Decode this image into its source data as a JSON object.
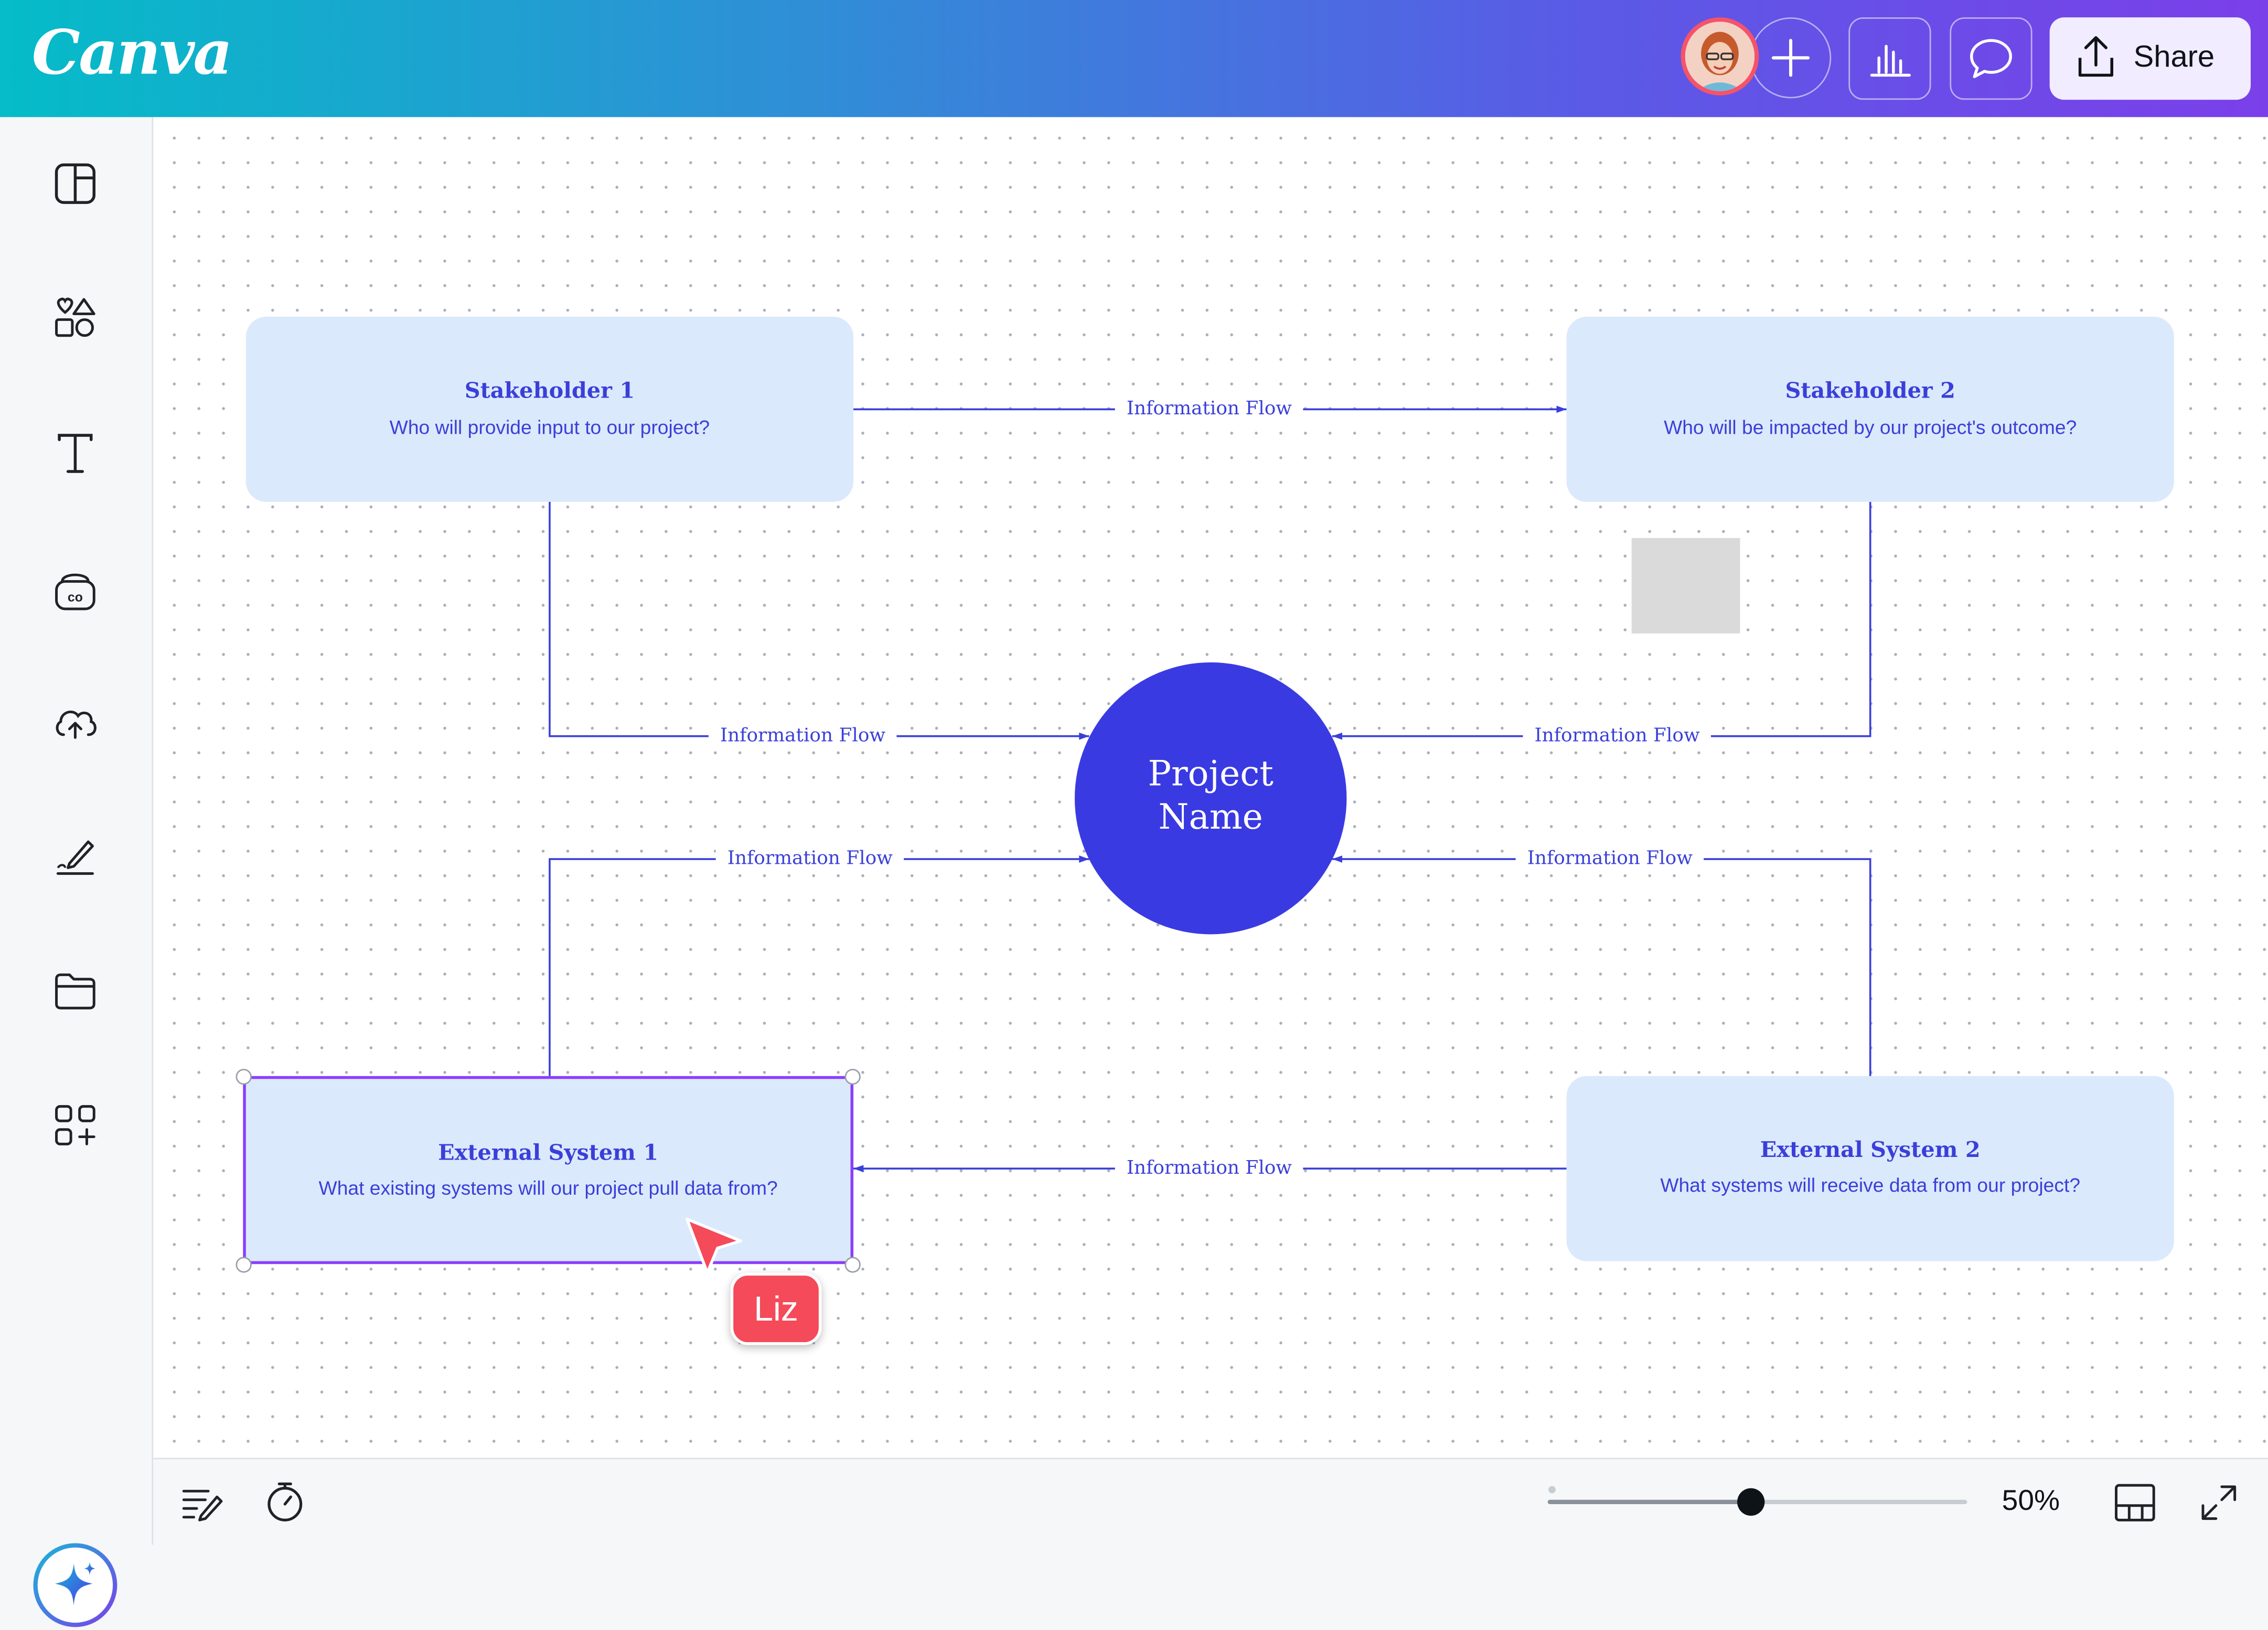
{
  "app": {
    "logo": "Canva"
  },
  "header": {
    "share_label": "Share",
    "collaborator_name": "Liz"
  },
  "diagram": {
    "center": {
      "line1": "Project",
      "line2": "Name"
    },
    "boxes": [
      {
        "title": "Stakeholder 1",
        "subtitle": "Who will provide input to our project?"
      },
      {
        "title": "Stakeholder 2",
        "subtitle": "Who will be impacted by our project's outcome?"
      },
      {
        "title": "External System 1",
        "subtitle": "What existing systems will our project pull data from?"
      },
      {
        "title": "External System 2",
        "subtitle": "What systems will receive data from our project?"
      }
    ],
    "flow_labels": [
      "Information Flow",
      "Information Flow",
      "Information Flow",
      "Information Flow",
      "Information Flow",
      "Information Flow"
    ]
  },
  "cursor": {
    "user": "Liz",
    "color": "#f44a59"
  },
  "footer": {
    "zoom": "50%",
    "zoom_value": 0.5
  },
  "colors": {
    "accent": "#3a3fd9",
    "box_fill": "#dbe9fc",
    "selection": "#8b3dff"
  }
}
